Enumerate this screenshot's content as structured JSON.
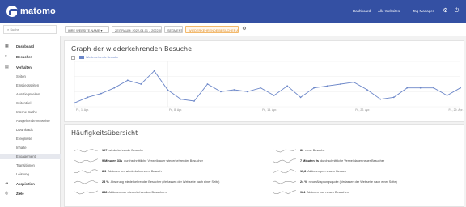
{
  "topbar": {
    "logo_text": "matomo",
    "nav": [
      "Dashboard",
      "Alle Websites",
      "Tag Manager"
    ],
    "icons": [
      "gear-icon",
      "power-icon"
    ],
    "bg_color": "#3450a3"
  },
  "controls": {
    "search_placeholder": "Suche",
    "pills": [
      "IHRE WEBSITE-NAME ▾",
      "ZEITRAUM: 2022-04-01 – 2022-04-30 ▾",
      "SEGMENT ▾",
      "WIEDERKEHRENDE BESUCHER ALLE ▾"
    ],
    "accent_color": "#e08a1e"
  },
  "sidebar": {
    "items": [
      {
        "icon": "dashboard-icon",
        "glyph": "▦",
        "label": "Dashboard",
        "type": "category"
      },
      {
        "icon": "visitors-icon",
        "glyph": "≈",
        "label": "Besucher",
        "type": "category"
      },
      {
        "icon": "behaviour-icon",
        "glyph": "▤",
        "label": "Verhalten",
        "type": "category"
      },
      {
        "label": "Seiten",
        "type": "sub"
      },
      {
        "label": "Einstiegsseiten",
        "type": "sub"
      },
      {
        "label": "Ausstiegsseiten",
        "type": "sub"
      },
      {
        "label": "Seitentitel",
        "type": "sub"
      },
      {
        "label": "Interne Suche",
        "type": "sub"
      },
      {
        "label": "Ausgehende Verweise",
        "type": "sub"
      },
      {
        "label": "Downloads",
        "type": "sub"
      },
      {
        "label": "Ereignisse",
        "type": "sub"
      },
      {
        "label": "Inhalte",
        "type": "sub"
      },
      {
        "label": "Engagement",
        "type": "sub",
        "selected": true
      },
      {
        "label": "Transitionen",
        "type": "sub"
      },
      {
        "label": "Leistung",
        "type": "sub"
      },
      {
        "icon": "acquisition-icon",
        "glyph": "⇥",
        "label": "Akquisition",
        "type": "category"
      },
      {
        "icon": "goals-icon",
        "glyph": "◎",
        "label": "Ziele",
        "type": "category"
      }
    ]
  },
  "graph": {
    "title": "Graph der wiederkehrenden Besuche",
    "legend": "Wiederkehrende Besuche"
  },
  "chart_data": {
    "type": "line",
    "title": "Graph der wiederkehrenden Besuche",
    "x_tick_labels": [
      "Fr., 1. Apr.",
      "Fr., 8. Apr.",
      "Fr., 15. Apr.",
      "Fr., 22. Apr.",
      "Fr., 29. Apr."
    ],
    "series": [
      {
        "name": "Wiederkehrende Besuche",
        "values": [
          2,
          5,
          7,
          10,
          14,
          12,
          19,
          9,
          4,
          3,
          12,
          8,
          9,
          8,
          10,
          6,
          11,
          5,
          10,
          11,
          12,
          13,
          9,
          4,
          5,
          10,
          10,
          10,
          6,
          10
        ]
      }
    ],
    "ylim": [
      0,
      24
    ],
    "grid": true,
    "line_color": "#6b86c8"
  },
  "overview": {
    "title": "Häufigkeitsübersicht",
    "rows": [
      {
        "value": "107",
        "text": "wiederkehrende Besuche"
      },
      {
        "value": "86",
        "text": "neue Besuche"
      },
      {
        "value": "9 Minuten 33s",
        "text": "durchschnittliche Verweildauer wiederkehrender Besucher"
      },
      {
        "value": "7 Minuten 9s",
        "text": "durchschnittliche Verweildauer neuer Besucher"
      },
      {
        "value": "8,3",
        "text": "Aktionen pro wiederkehrendem Besuch"
      },
      {
        "value": "11,8",
        "text": "Aktionen pro neuem Besuch"
      },
      {
        "value": "28 %",
        "text": "Absprung wiederkehrender Besucher (Verlassen der Webseite nach einer Seite)"
      },
      {
        "value": "24 %",
        "text": "neue Absprungsquote (Verlassen der Webseite nach einer Seite)"
      },
      {
        "value": "888",
        "text": "Aktionen von wiederkehrenden Besuchern"
      },
      {
        "value": "984",
        "text": "Aktionen von neuen Besuchern"
      }
    ]
  }
}
